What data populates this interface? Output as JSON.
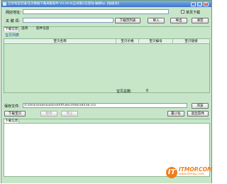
{
  "window": {
    "title": "兰亭淘宝店铺/宝贝数据下载采集软件 V3.24.0(正式版)(已登陆 破解by【福福多】",
    "minimize": "_",
    "maximize": "□",
    "close": "×"
  },
  "form": {
    "shop_url_label": "网店地址:",
    "shop_url_value": "",
    "single_page_label": "单页下载",
    "keyword_label": "关 键 词:",
    "keyword_value": "",
    "download_page_button": "下载页列表",
    "import_button": "导入",
    "export_button": "导出",
    "clear_button": "清空"
  },
  "tabs": {
    "main_tab": "下载信息",
    "options_tab": "选项",
    "software_info_tab": "软件信息"
  },
  "table": {
    "section_label": "宝贝列表",
    "columns": [
      "宝贝名称",
      "宝贝价格",
      "宝贝编号",
      "宝贝链接"
    ],
    "total_label": "宝贝总数:",
    "total_value": "0"
  },
  "save": {
    "label": "保存文件:",
    "path": "d:\\desk\\Downloads\\dd\\fff38\\cmt8038\\f38.csv",
    "browse_button": "浏览"
  },
  "controls": {
    "download_button": "下载宝贝",
    "pause_button": "暂停",
    "stop_button": "停止",
    "minimize_button": "最小化",
    "exit_button": "退出软件"
  },
  "log": {
    "tab_label": "下载信息"
  },
  "watermark": {
    "brand": "ITMOP.COM",
    "url": "www.itmop.com"
  },
  "colors": {
    "panel": "#c7e6c9",
    "titlebar": "#3d74c8",
    "logo": "#f07d1e"
  }
}
